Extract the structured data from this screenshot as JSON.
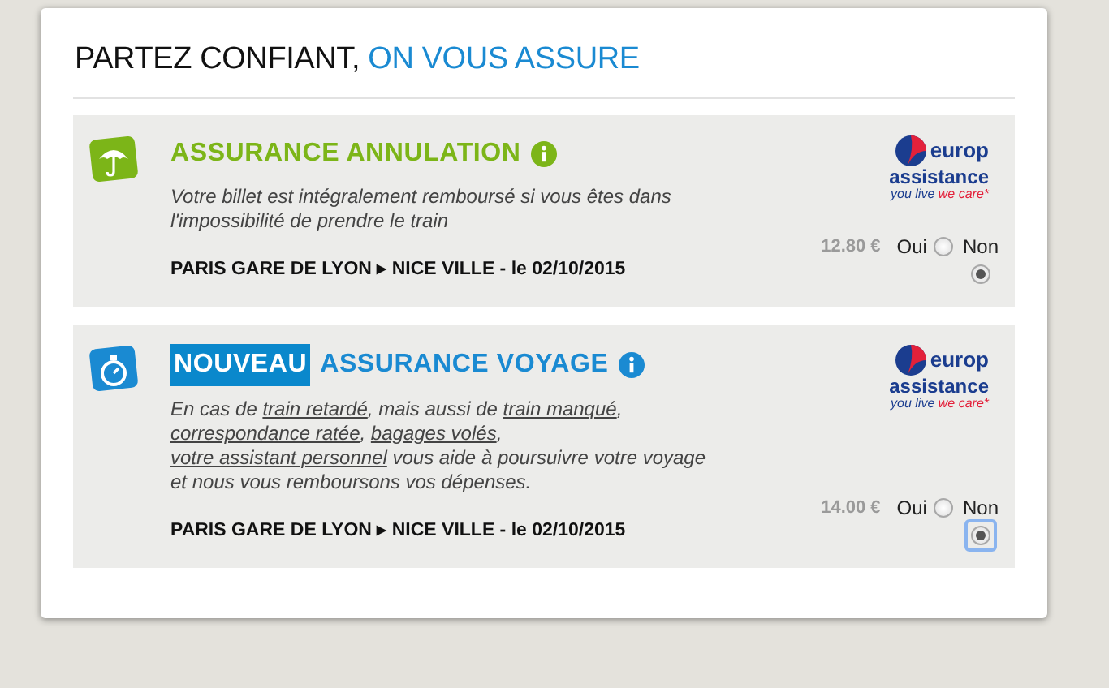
{
  "heading": {
    "text": "PARTEZ CONFIANT,",
    "accent": "ON VOUS ASSURE"
  },
  "offers": [
    {
      "kind": "umbrella",
      "title": "ASSURANCE ANNULATION",
      "description": [
        {
          "kind": "text",
          "text": "Votre billet est intégralement remboursé si vous êtes dans l'impossibilité de prendre le train"
        }
      ],
      "route_from": "PARIS GARE DE LYON",
      "arrow": "▸",
      "route_to": "NICE VILLE - le 02/10/2015",
      "price": "12.80 €",
      "logo": {
        "line1": "europ",
        "line2": "assistance",
        "tag_a": "you live",
        "tag_b": "we care*"
      },
      "options": [
        {
          "label": "Oui",
          "selected": false,
          "focused": false
        },
        {
          "label": "Non",
          "selected": true,
          "focused": false
        }
      ]
    },
    {
      "kind": "stopwatch",
      "badge": "NOUVEAU",
      "title": "ASSURANCE VOYAGE",
      "description": [
        {
          "kind": "text",
          "text": "En cas de "
        },
        {
          "kind": "link",
          "text": "train retardé"
        },
        {
          "kind": "text",
          "text": ", mais aussi de "
        },
        {
          "kind": "link",
          "text": "train manqué"
        },
        {
          "kind": "text",
          "text": ", "
        },
        {
          "kind": "link",
          "text": "correspondance ratée"
        },
        {
          "kind": "text",
          "text": ", "
        },
        {
          "kind": "link",
          "text": "bagages volés"
        },
        {
          "kind": "text",
          "text": ", "
        },
        {
          "kind": "link",
          "text": "votre assistant personnel"
        },
        {
          "kind": "text",
          "text": " vous aide à poursuivre votre voyage et nous vous remboursons vos dépenses."
        }
      ],
      "route_from": "PARIS GARE DE LYON",
      "arrow": "▸",
      "route_to": "NICE VILLE - le 02/10/2015",
      "price": "14.00 €",
      "logo": {
        "line1": "europ",
        "line2": "assistance",
        "tag_a": "you live",
        "tag_b": "we care*"
      },
      "options": [
        {
          "label": "Oui",
          "selected": false,
          "focused": false
        },
        {
          "label": "Non",
          "selected": true,
          "focused": true
        }
      ]
    }
  ]
}
